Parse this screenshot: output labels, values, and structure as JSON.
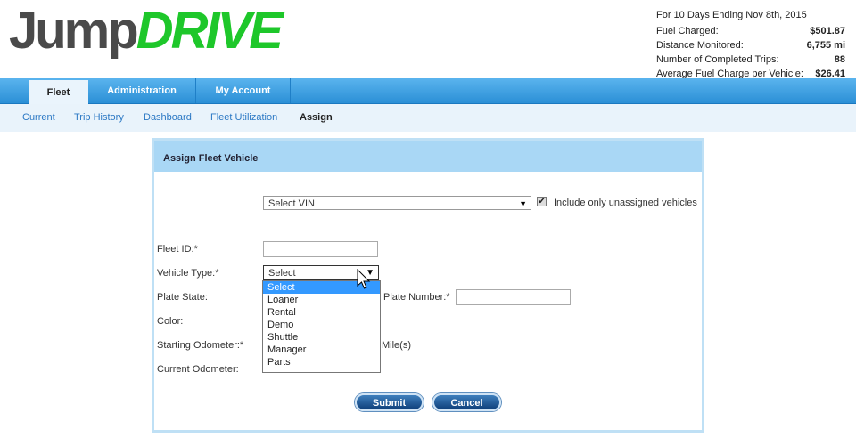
{
  "header": {
    "logo_part1": "Jump",
    "logo_part2": "DRIVE",
    "stats": {
      "period": "For 10 Days Ending Nov 8th, 2015",
      "rows": [
        {
          "label": "Fuel Charged:",
          "value": "$501.87"
        },
        {
          "label": "Distance Monitored:",
          "value": "6,755 mi"
        },
        {
          "label": "Number of Completed Trips:",
          "value": "88"
        },
        {
          "label": "Average Fuel Charge per Vehicle:",
          "value": "$26.41"
        }
      ]
    }
  },
  "nav": {
    "tabs": [
      "Fleet",
      "Administration",
      "My Account"
    ],
    "subtabs": [
      "Current",
      "Trip History",
      "Dashboard",
      "Fleet Utilization",
      "Assign"
    ]
  },
  "form": {
    "title": "Assign Fleet Vehicle",
    "vin_select": "Select VIN",
    "unassigned_label": "Include only unassigned vehicles",
    "fleet_id_label": "Fleet ID:*",
    "vehicle_type_label": "Vehicle Type:*",
    "vehicle_type_value": "Select",
    "vehicle_type_options": [
      "Select",
      "Loaner",
      "Rental",
      "Demo",
      "Shuttle",
      "Manager",
      "Parts"
    ],
    "plate_state_label": "Plate State:",
    "plate_number_label": "Plate Number:*",
    "color_label": "Color:",
    "starting_odometer_label": "Starting Odometer:*",
    "miles_label": "Mile(s)",
    "current_odometer_label": "Current Odometer:",
    "submit_label": "Submit",
    "cancel_label": "Cancel"
  }
}
